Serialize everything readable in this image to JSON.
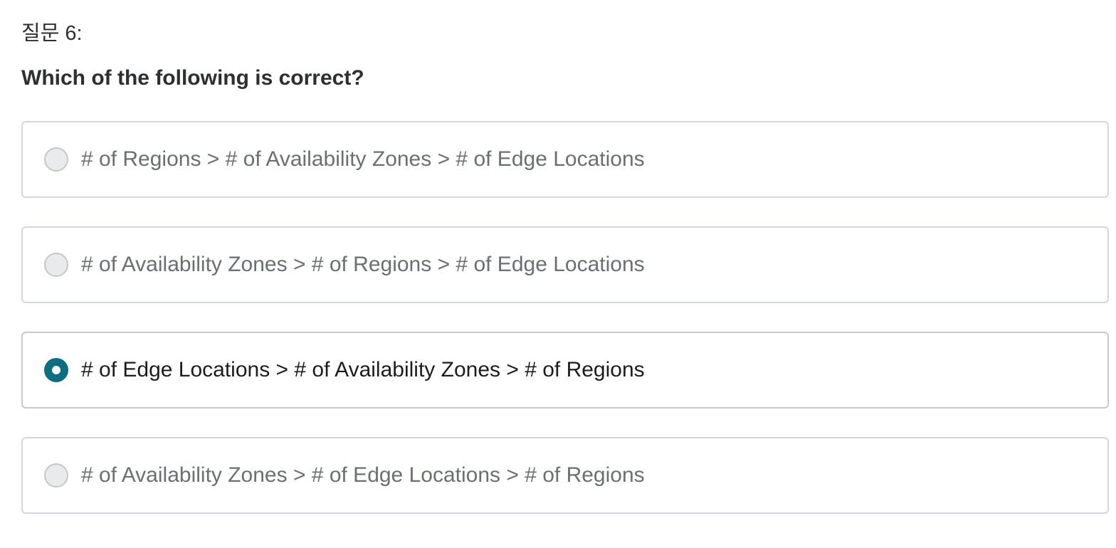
{
  "question": {
    "label": "질문 6:",
    "prompt": "Which of the following is correct?"
  },
  "options": [
    {
      "text": "# of Regions > # of Availability Zones > # of Edge Locations",
      "selected": false
    },
    {
      "text": "# of Availability Zones > # of Regions > # of Edge Locations",
      "selected": false
    },
    {
      "text": "# of Edge Locations > # of Availability Zones > # of Regions",
      "selected": true
    },
    {
      "text": "# of Availability Zones > # of Edge Locations > # of Regions",
      "selected": false
    }
  ],
  "colors": {
    "accent": "#0d6e80",
    "border": "#d1d7dc",
    "unselected_text": "#6a6f73",
    "selected_text": "#1c1d1f"
  }
}
